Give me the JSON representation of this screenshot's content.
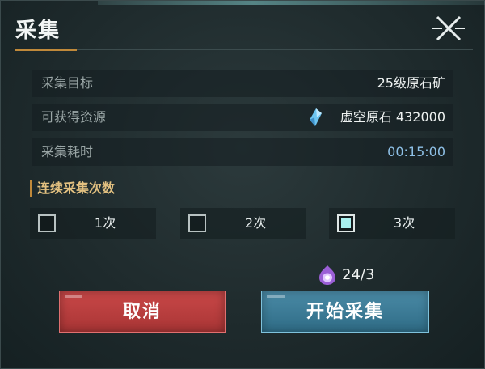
{
  "dialog": {
    "title": "采集",
    "close_icon": "close-x-icon"
  },
  "info": [
    {
      "label": "采集目标",
      "value": "25级原石矿"
    },
    {
      "label": "可获得资源",
      "value": "虚空原石 432000",
      "icon": "crystal-icon"
    },
    {
      "label": "采集耗时",
      "value": "00:15:00"
    }
  ],
  "count_section": {
    "label": "连续采集次数",
    "options": [
      {
        "label": "1次",
        "checked": false
      },
      {
        "label": "2次",
        "checked": false
      },
      {
        "label": "3次",
        "checked": true
      }
    ]
  },
  "stamina": {
    "icon": "energy-orb-icon",
    "value": "24/3"
  },
  "buttons": {
    "cancel": "取消",
    "start": "开始采集"
  },
  "colors": {
    "accent": "#c0893a",
    "cancel": "#c94848",
    "start": "#3d7c98",
    "time": "#8ec0e6",
    "checkbox_fill": "#a8f0ee"
  }
}
